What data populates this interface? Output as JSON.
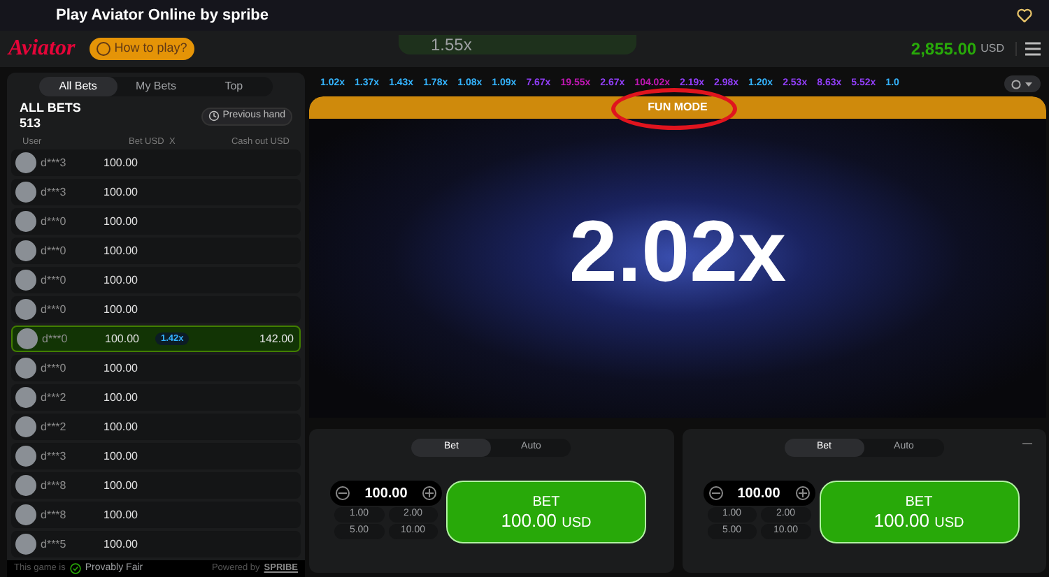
{
  "page_title": "Play Aviator Online by spribe",
  "topbar": {
    "logo": "Aviator",
    "how_to_play": "How to play?",
    "toast_multiplier": "1.55x",
    "balance": "2,855.00",
    "currency": "USD"
  },
  "bets_panel": {
    "tabs": [
      {
        "label": "All Bets",
        "selected": true
      },
      {
        "label": "My Bets",
        "selected": false
      },
      {
        "label": "Top",
        "selected": false
      }
    ],
    "title": "ALL BETS",
    "count": "513",
    "previous_hand": "Previous hand",
    "columns": [
      "User",
      "Bet USD",
      "X",
      "Cash out USD"
    ],
    "rows": [
      {
        "user": "d***3",
        "bet": "100.00",
        "cashed_out": false
      },
      {
        "user": "d***3",
        "bet": "100.00",
        "cashed_out": false
      },
      {
        "user": "d***0",
        "bet": "100.00",
        "cashed_out": false
      },
      {
        "user": "d***0",
        "bet": "100.00",
        "cashed_out": false
      },
      {
        "user": "d***0",
        "bet": "100.00",
        "cashed_out": false
      },
      {
        "user": "d***0",
        "bet": "100.00",
        "cashed_out": false
      },
      {
        "user": "d***0",
        "bet": "100.00",
        "cashed_out": true,
        "multiplier": "1.42x",
        "cash_out": "142.00"
      },
      {
        "user": "d***0",
        "bet": "100.00",
        "cashed_out": false
      },
      {
        "user": "d***2",
        "bet": "100.00",
        "cashed_out": false
      },
      {
        "user": "d***2",
        "bet": "100.00",
        "cashed_out": false
      },
      {
        "user": "d***3",
        "bet": "100.00",
        "cashed_out": false
      },
      {
        "user": "d***8",
        "bet": "100.00",
        "cashed_out": false
      },
      {
        "user": "d***8",
        "bet": "100.00",
        "cashed_out": false
      },
      {
        "user": "d***5",
        "bet": "100.00",
        "cashed_out": false
      }
    ],
    "footer": {
      "prefix": "This game is",
      "provably_fair": "Provably Fair",
      "powered_by": "Powered by",
      "brand": "SPRIBE"
    }
  },
  "history": [
    {
      "value": "1.02x",
      "color": "#34b4ff"
    },
    {
      "value": "1.37x",
      "color": "#34b4ff"
    },
    {
      "value": "1.43x",
      "color": "#34b4ff"
    },
    {
      "value": "1.78x",
      "color": "#34b4ff"
    },
    {
      "value": "1.08x",
      "color": "#34b4ff"
    },
    {
      "value": "1.09x",
      "color": "#34b4ff"
    },
    {
      "value": "7.67x",
      "color": "#913ef8"
    },
    {
      "value": "19.55x",
      "color": "#c017b4"
    },
    {
      "value": "2.67x",
      "color": "#913ef8"
    },
    {
      "value": "104.02x",
      "color": "#c017b4"
    },
    {
      "value": "2.19x",
      "color": "#913ef8"
    },
    {
      "value": "2.98x",
      "color": "#913ef8"
    },
    {
      "value": "1.20x",
      "color": "#34b4ff"
    },
    {
      "value": "2.53x",
      "color": "#913ef8"
    },
    {
      "value": "8.63x",
      "color": "#913ef8"
    },
    {
      "value": "5.52x",
      "color": "#913ef8"
    },
    {
      "value": "1.0",
      "color": "#34b4ff"
    }
  ],
  "game": {
    "mode_banner": "FUN MODE",
    "multiplier": "2.02x"
  },
  "bet_panels": [
    {
      "tabs": [
        {
          "label": "Bet",
          "selected": true
        },
        {
          "label": "Auto",
          "selected": false
        }
      ],
      "amount": "100.00",
      "chips": [
        "1.00",
        "2.00",
        "5.00",
        "10.00"
      ],
      "button_label": "BET",
      "button_amount": "100.00",
      "button_currency": "USD",
      "removable": false
    },
    {
      "tabs": [
        {
          "label": "Bet",
          "selected": true
        },
        {
          "label": "Auto",
          "selected": false
        }
      ],
      "amount": "100.00",
      "chips": [
        "1.00",
        "2.00",
        "5.00",
        "10.00"
      ],
      "button_label": "BET",
      "button_amount": "100.00",
      "button_currency": "USD",
      "removable": true
    }
  ]
}
